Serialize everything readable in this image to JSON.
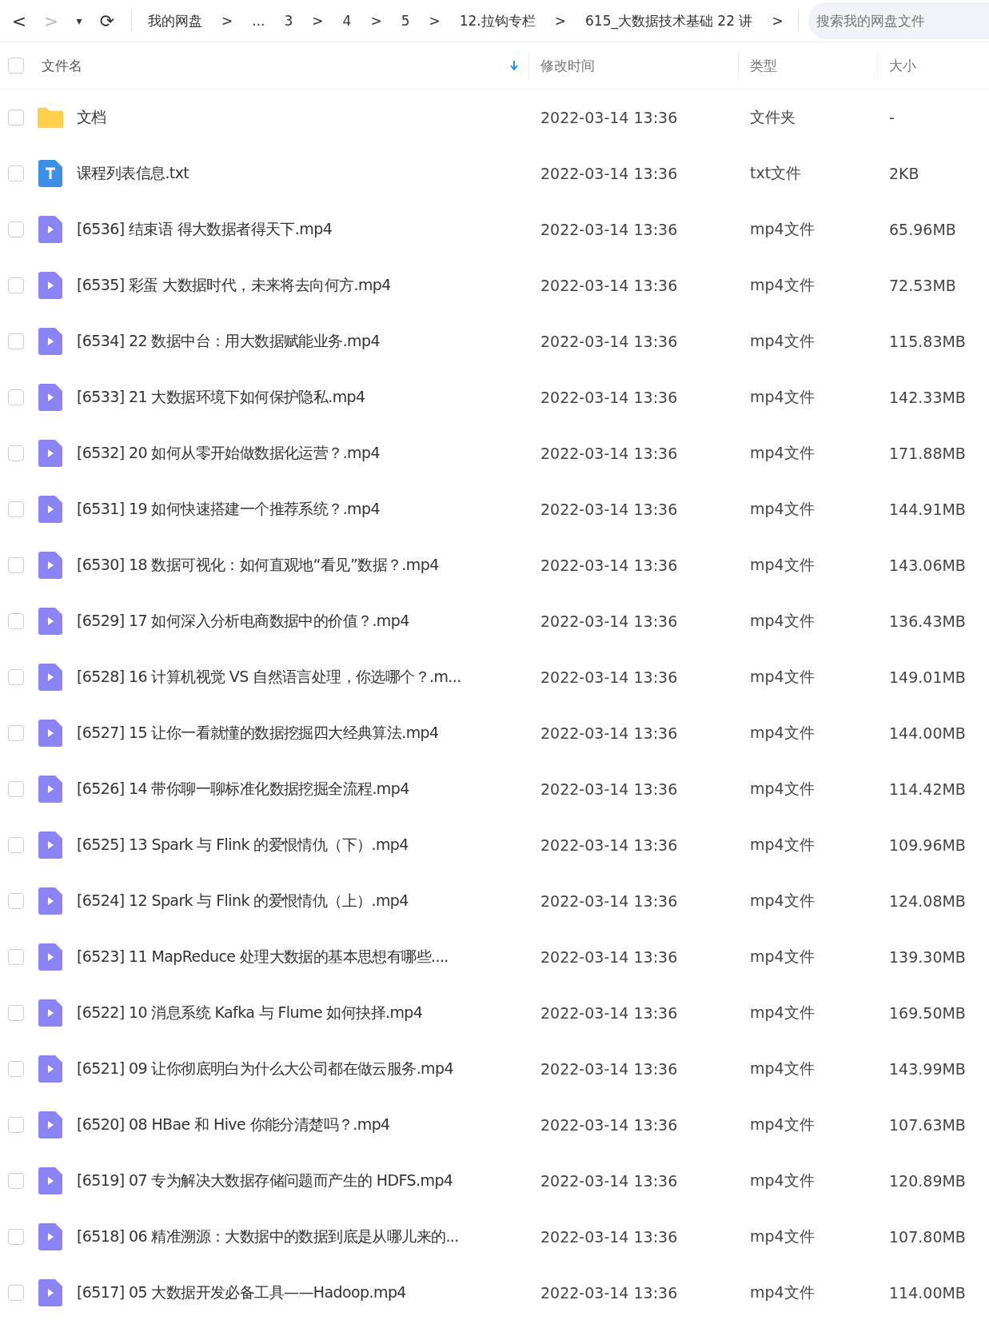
{
  "toolbar": {
    "back": "<",
    "forward": ">",
    "dropdown": "▾",
    "refresh": "⟳",
    "breadcrumbs": [
      "我的网盘",
      ">",
      "...",
      "3",
      ">",
      "4",
      ">",
      "5",
      ">",
      "12.拉钩专栏",
      ">",
      "615_大数据技术基础 22 讲",
      ">"
    ],
    "search": {
      "placeholder": "搜索我的网盘文件"
    }
  },
  "table": {
    "select_all": {
      "checked": false
    },
    "columns": [
      {
        "label": "文件名",
        "sorted": true
      },
      {
        "label": "修改时间",
        "sorted": false
      },
      {
        "label": "类型",
        "sorted": false
      },
      {
        "label": "大小",
        "sorted": false
      }
    ],
    "rows": [
      {
        "kind": "folder",
        "checked": false,
        "name": "文档",
        "modified": "2022-03-14 13:36",
        "type": "文件夹",
        "size": "-"
      },
      {
        "kind": "text",
        "checked": false,
        "name": "课程列表信息.txt",
        "modified": "2022-03-14 13:36",
        "type": "txt文件",
        "size": "2KB"
      },
      {
        "kind": "video",
        "checked": false,
        "name": "[6536] 结束语  得大数据者得天下.mp4",
        "modified": "2022-03-14 13:36",
        "type": "mp4文件",
        "size": "65.96MB"
      },
      {
        "kind": "video",
        "checked": false,
        "name": "[6535] 彩蛋  大数据时代，未来将去向何方.mp4",
        "modified": "2022-03-14 13:36",
        "type": "mp4文件",
        "size": "72.53MB"
      },
      {
        "kind": "video",
        "checked": false,
        "name": "[6534] 22  数据中台：用大数据赋能业务.mp4",
        "modified": "2022-03-14 13:36",
        "type": "mp4文件",
        "size": "115.83MB"
      },
      {
        "kind": "video",
        "checked": false,
        "name": "[6533] 21  大数据环境下如何保护隐私.mp4",
        "modified": "2022-03-14 13:36",
        "type": "mp4文件",
        "size": "142.33MB"
      },
      {
        "kind": "video",
        "checked": false,
        "name": "[6532] 20  如何从零开始做数据化运营？.mp4",
        "modified": "2022-03-14 13:36",
        "type": "mp4文件",
        "size": "171.88MB"
      },
      {
        "kind": "video",
        "checked": false,
        "name": "[6531] 19  如何快速搭建一个推荐系统？.mp4",
        "modified": "2022-03-14 13:36",
        "type": "mp4文件",
        "size": "144.91MB"
      },
      {
        "kind": "video",
        "checked": false,
        "name": "[6530] 18  数据可视化：如何直观地“看见”数据？.mp4",
        "modified": "2022-03-14 13:36",
        "type": "mp4文件",
        "size": "143.06MB"
      },
      {
        "kind": "video",
        "checked": false,
        "name": "[6529] 17  如何深入分析电商数据中的价值？.mp4",
        "modified": "2022-03-14 13:36",
        "type": "mp4文件",
        "size": "136.43MB"
      },
      {
        "kind": "video",
        "checked": false,
        "name": "[6528] 16  计算机视觉 VS 自然语言处理，你选哪个？.m...",
        "modified": "2022-03-14 13:36",
        "type": "mp4文件",
        "size": "149.01MB"
      },
      {
        "kind": "video",
        "checked": false,
        "name": "[6527] 15  让你一看就懂的数据挖掘四大经典算法.mp4",
        "modified": "2022-03-14 13:36",
        "type": "mp4文件",
        "size": "144.00MB"
      },
      {
        "kind": "video",
        "checked": false,
        "name": "[6526] 14  带你聊一聊标准化数据挖掘全流程.mp4",
        "modified": "2022-03-14 13:36",
        "type": "mp4文件",
        "size": "114.42MB"
      },
      {
        "kind": "video",
        "checked": false,
        "name": "[6525] 13  Spark 与 Flink 的爱恨情仇（下）.mp4",
        "modified": "2022-03-14 13:36",
        "type": "mp4文件",
        "size": "109.96MB"
      },
      {
        "kind": "video",
        "checked": false,
        "name": "[6524] 12  Spark 与 Flink 的爱恨情仇（上）.mp4",
        "modified": "2022-03-14 13:36",
        "type": "mp4文件",
        "size": "124.08MB"
      },
      {
        "kind": "video",
        "checked": false,
        "name": "[6523] 11  MapReduce 处理大数据的基本思想有哪些....",
        "modified": "2022-03-14 13:36",
        "type": "mp4文件",
        "size": "139.30MB"
      },
      {
        "kind": "video",
        "checked": false,
        "name": "[6522] 10  消息系统 Kafka 与 Flume 如何抉择.mp4",
        "modified": "2022-03-14 13:36",
        "type": "mp4文件",
        "size": "169.50MB"
      },
      {
        "kind": "video",
        "checked": false,
        "name": "[6521] 09  让你彻底明白为什么大公司都在做云服务.mp4",
        "modified": "2022-03-14 13:36",
        "type": "mp4文件",
        "size": "143.99MB"
      },
      {
        "kind": "video",
        "checked": false,
        "name": "[6520] 08  HBae 和 Hive 你能分清楚吗？.mp4",
        "modified": "2022-03-14 13:36",
        "type": "mp4文件",
        "size": "107.63MB"
      },
      {
        "kind": "video",
        "checked": false,
        "name": "[6519] 07  专为解决大数据存储问题而产生的 HDFS.mp4",
        "modified": "2022-03-14 13:36",
        "type": "mp4文件",
        "size": "120.89MB"
      },
      {
        "kind": "video",
        "checked": false,
        "name": "[6518] 06  精准溯源：大数据中的数据到底是从哪儿来的...",
        "modified": "2022-03-14 13:36",
        "type": "mp4文件",
        "size": "107.80MB"
      },
      {
        "kind": "video",
        "checked": false,
        "name": "[6517] 05  大数据开发必备工具——Hadoop.mp4",
        "modified": "2022-03-14 13:36",
        "type": "mp4文件",
        "size": "114.00MB"
      }
    ]
  }
}
